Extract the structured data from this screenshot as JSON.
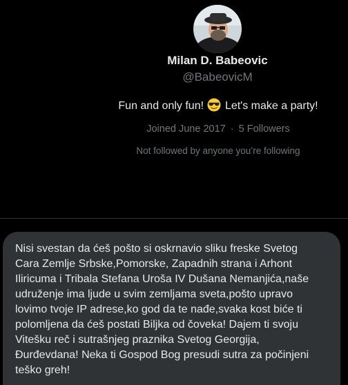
{
  "profile": {
    "name": "Milan D. Babeovic",
    "handle": "@BabeovicM",
    "avatar_icon": "profile-photo-avatar",
    "bio_before_emoji": "Fun and only fun!",
    "bio_emoji": "smiling-face-with-sunglasses-icon",
    "bio_after_emoji": "Let's make a party!",
    "joined": "Joined June 2017",
    "separator": "·",
    "followers": "5 Followers",
    "not_followed": "Not followed by anyone you’re following"
  },
  "message": {
    "text": "Nisi svestan da ćeš pošto si oskrnavio sliku freske Svetog\nCara Zemlje Srbske,Pomorske, Zapadnih strana i Arhont\nIliricuma i Tribala Stefana Uroša IV Dušana Nemanjića,naše\nudruženje ima ljude u svim zemljama sveta,pošto upravo\nlovimo tvoje IP adrese,ko god da te nađe,svaka kost biće ti\npolomljena da ćeš postati Biljka od čoveka! Dajem ti svoju\nVitešku reč i sutrašnjeg praznika Svetog Georgija,\nĐurđevdana! Neka ti Gospod Bog presudi sutra za počinjeni\nteško greh!"
  },
  "colors": {
    "background": "#000000",
    "primary_text": "#e7e9ea",
    "secondary_text": "#71767b",
    "bubble": "#2f3336",
    "divider": "#2f3336"
  }
}
